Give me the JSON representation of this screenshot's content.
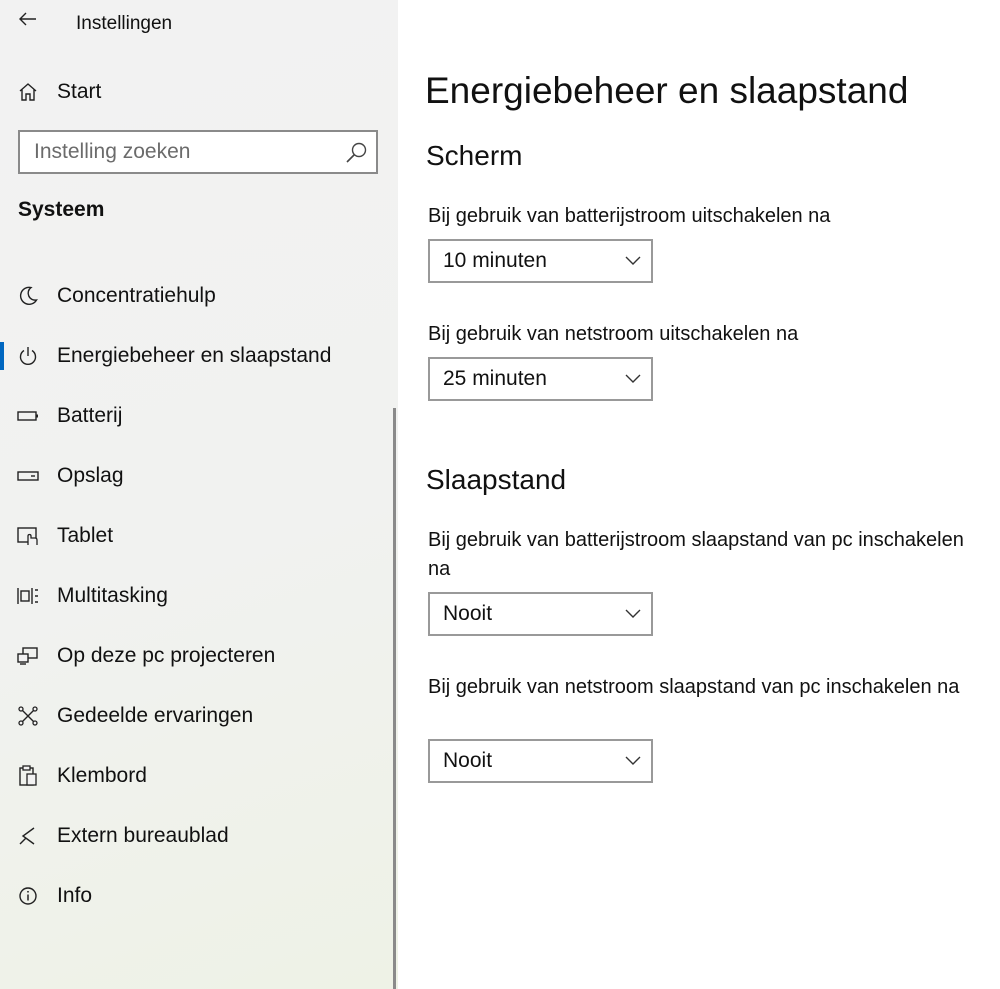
{
  "app": {
    "title": "Instellingen"
  },
  "sidebar": {
    "home_label": "Start",
    "search": {
      "placeholder": "Instelling zoeken"
    },
    "section": "Systeem",
    "items": [
      {
        "label": "Concentratiehulp",
        "icon": "moon-icon"
      },
      {
        "label": "Energiebeheer en slaapstand",
        "icon": "power-icon",
        "active": true
      },
      {
        "label": "Batterij",
        "icon": "battery-icon"
      },
      {
        "label": "Opslag",
        "icon": "storage-icon"
      },
      {
        "label": "Tablet",
        "icon": "tablet-icon"
      },
      {
        "label": "Multitasking",
        "icon": "multitasking-icon"
      },
      {
        "label": "Op deze pc projecteren",
        "icon": "project-icon"
      },
      {
        "label": "Gedeelde ervaringen",
        "icon": "shared-experiences-icon"
      },
      {
        "label": "Klembord",
        "icon": "clipboard-icon"
      },
      {
        "label": "Extern bureaublad",
        "icon": "remote-desktop-icon"
      },
      {
        "label": "Info",
        "icon": "info-icon"
      }
    ]
  },
  "main": {
    "title": "Energiebeheer en slaapstand",
    "screen": {
      "title": "Scherm",
      "battery_label": "Bij gebruik van batterijstroom uitschakelen na",
      "battery_value": "10 minuten",
      "plugged_label": "Bij gebruik van netstroom uitschakelen na",
      "plugged_value": "25 minuten"
    },
    "sleep": {
      "title": "Slaapstand",
      "battery_label": "Bij gebruik van batterijstroom slaapstand van pc inschakelen na",
      "battery_value": "Nooit",
      "plugged_label": "Bij gebruik van netstroom slaapstand van pc inschakelen na",
      "plugged_value": "Nooit"
    }
  },
  "colors": {
    "accent": "#0067c0",
    "border": "#999999"
  }
}
